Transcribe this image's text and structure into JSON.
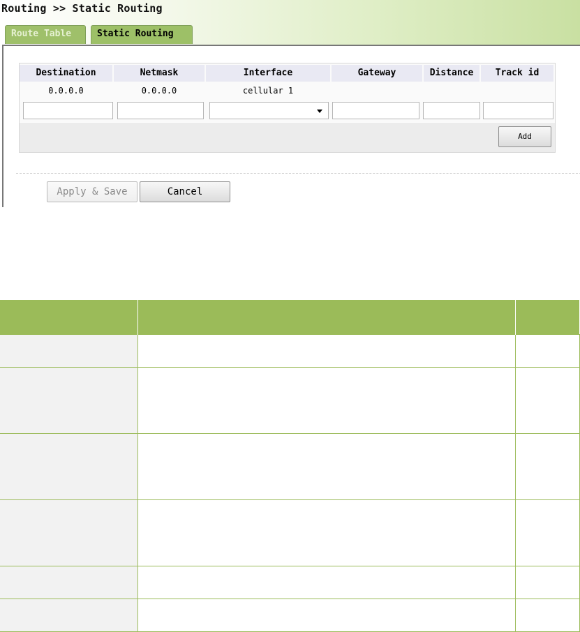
{
  "breadcrumb": {
    "title": "Routing >> Static Routing"
  },
  "tabs": [
    {
      "label": "Route Table",
      "active": false
    },
    {
      "label": "Static Routing",
      "active": true
    }
  ],
  "route_table": {
    "columns": [
      "Destination",
      "Netmask",
      "Interface",
      "Gateway",
      "Distance",
      "Track id"
    ],
    "rows": [
      {
        "destination": "0.0.0.0",
        "netmask": "0.0.0.0",
        "interface": "cellular 1",
        "gateway": "",
        "distance": "",
        "track_id": ""
      }
    ],
    "new_entry": {
      "destination": "",
      "netmask": "",
      "interface": "",
      "gateway": "",
      "distance": "",
      "track_id": ""
    },
    "add_label": "Add"
  },
  "actions": {
    "apply_label": "Apply & Save",
    "cancel_label": "Cancel"
  },
  "colors": {
    "tab_active": "#9dc067",
    "table_header": "#9bbb59",
    "column_header": "#e9e9f3"
  }
}
